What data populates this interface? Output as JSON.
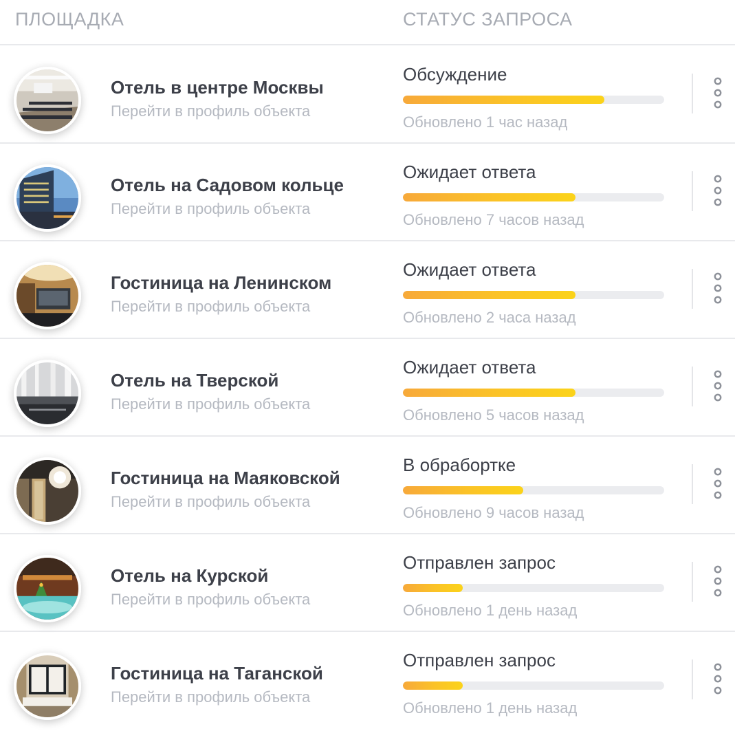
{
  "header": {
    "venue_column": "ПЛОЩАДКА",
    "status_column": "СТАТУС ЗАПРОСА"
  },
  "rows": [
    {
      "name": "Отель в центре Москвы",
      "link": "Перейти в профиль объекта",
      "status": "Обсуждение",
      "progress": 0.77,
      "updated": "Обновлено 1 час назад",
      "photo": "conference-hall-photo"
    },
    {
      "name": "Отель на Садовом кольце",
      "link": "Перейти в профиль объекта",
      "status": "Ожидает ответа",
      "progress": 0.66,
      "updated": "Обновлено 7 часов назад",
      "photo": "night-building-photo"
    },
    {
      "name": "Гостиница на Ленинском",
      "link": "Перейти в профиль объекта",
      "status": "Ожидает ответа",
      "progress": 0.66,
      "updated": "Обновлено 2 часа назад",
      "photo": "hotel-lobby-photo"
    },
    {
      "name": "Отель на Тверской",
      "link": "Перейти в профиль объекта",
      "status": "Ожидает ответа",
      "progress": 0.66,
      "updated": "Обновлено 5 часов назад",
      "photo": "glass-hall-photo"
    },
    {
      "name": "Гостиница на Маяковской",
      "link": "Перейти в профиль объекта",
      "status": "В обрабортке",
      "progress": 0.46,
      "updated": "Обновлено 9 часов назад",
      "photo": "chandelier-lobby-photo"
    },
    {
      "name": "Отель на Курской",
      "link": "Перейти в профиль объекта",
      "status": "Отправлен запрос",
      "progress": 0.23,
      "updated": "Обновлено 1 день назад",
      "photo": "fountain-atrium-photo"
    },
    {
      "name": "Гостиница на Таганской",
      "link": "Перейти в профиль объекта",
      "status": "Отправлен запрос",
      "progress": 0.23,
      "updated": "Обновлено 1 день назад",
      "photo": "classic-lounge-photo"
    }
  ],
  "colors": {
    "progress_start": "#f7a93a",
    "progress_end": "#fbd31a",
    "track": "#ebecef",
    "text_primary": "#3d4049",
    "text_muted": "#b5b9c1"
  },
  "icons": {
    "more": "vertical-dots-icon"
  }
}
